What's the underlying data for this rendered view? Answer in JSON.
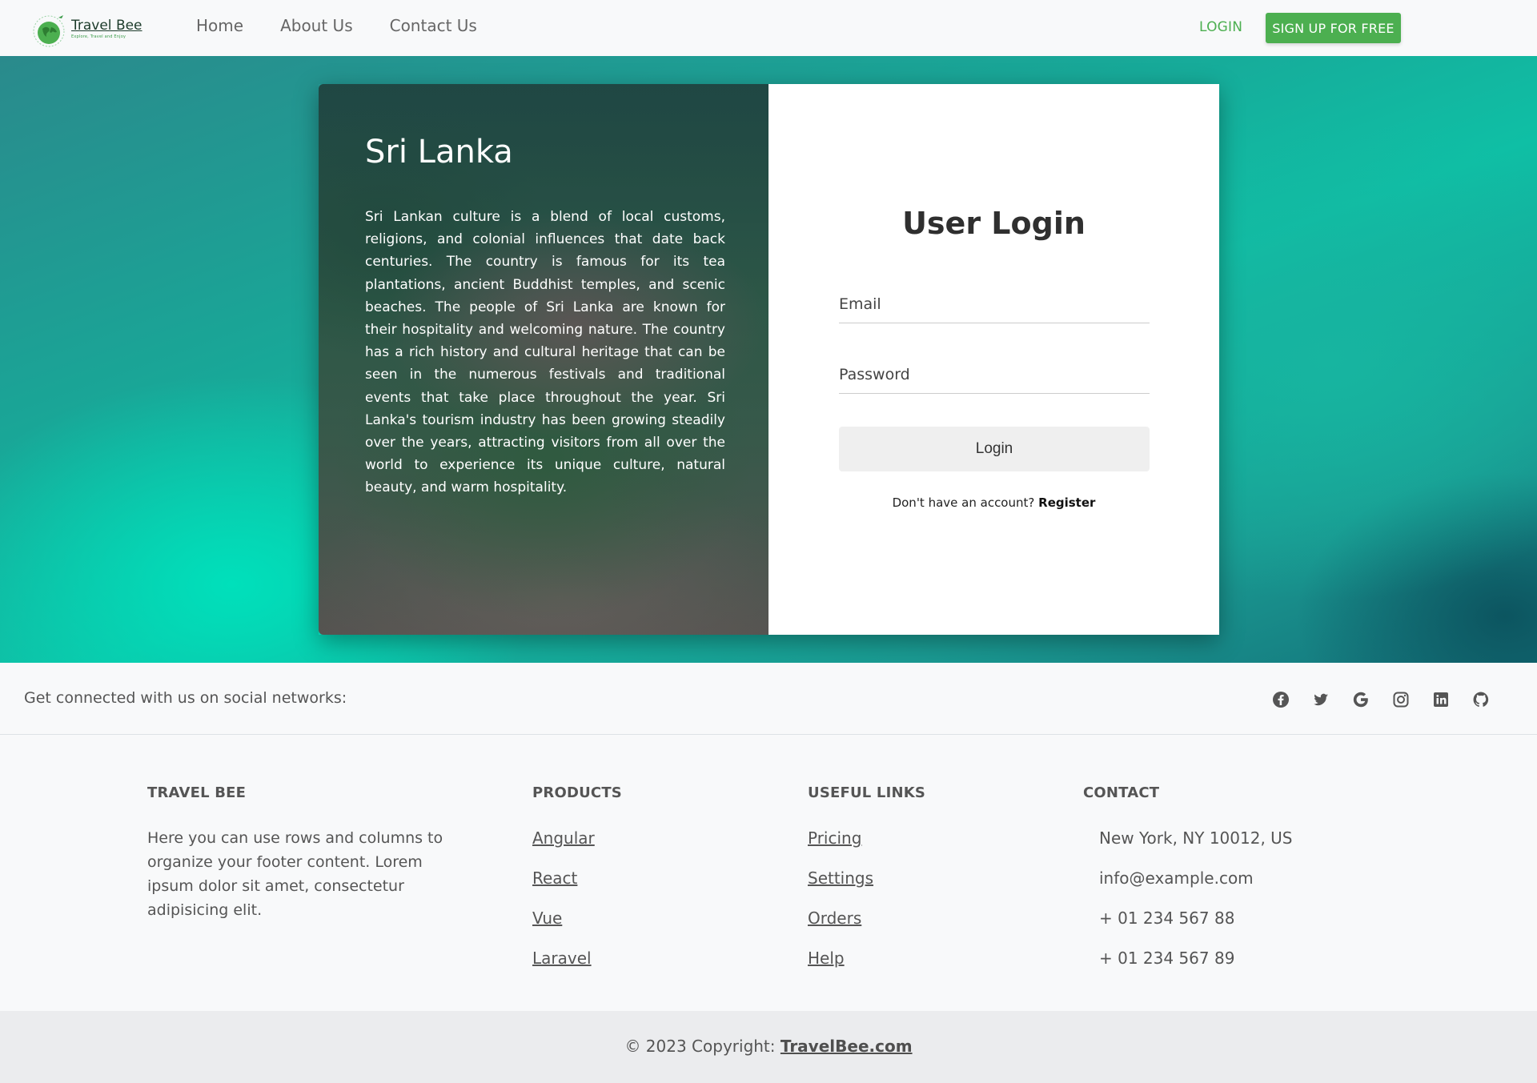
{
  "navbar": {
    "brand_name": "Travel Bee",
    "brand_tagline": "Explore, Travel and Enjoy",
    "links": [
      "Home",
      "About Us",
      "Contact Us"
    ],
    "login_label": "LOGIN",
    "signup_label": "SIGN UP FOR FREE"
  },
  "hero": {
    "title": "Sri Lanka",
    "description": "Sri Lankan culture is a blend of local customs, religions, and colonial influences that date back centuries. The country is famous for its tea plantations, ancient Buddhist temples, and scenic beaches. The people of Sri Lanka are known for their hospitality and welcoming nature. The country has a rich history and cultural heritage that can be seen in the numerous festivals and traditional events that take place throughout the year. Sri Lanka's tourism industry has been growing steadily over the years, attracting visitors from all over the world to experience its unique culture, natural beauty, and warm hospitality."
  },
  "login_form": {
    "title": "User Login",
    "email_placeholder": "Email",
    "password_placeholder": "Password",
    "submit_label": "Login",
    "register_prompt": "Don't have an account?",
    "register_link": "Register"
  },
  "social": {
    "text": "Get connected with us on social networks:",
    "icons": [
      "facebook-icon",
      "twitter-icon",
      "google-icon",
      "instagram-icon",
      "linkedin-icon",
      "github-icon"
    ]
  },
  "footer": {
    "about_title": "TRAVEL BEE",
    "about_text": "Here you can use rows and columns to organize your footer content. Lorem ipsum dolor sit amet, consectetur adipisicing elit.",
    "products_title": "PRODUCTS",
    "products": [
      "Angular",
      "React",
      "Vue",
      "Laravel"
    ],
    "useful_title": "USEFUL LINKS",
    "useful_links": [
      "Pricing",
      "Settings",
      "Orders",
      "Help"
    ],
    "contact_title": "CONTACT",
    "contact": [
      "New York, NY 10012, US",
      "info@example.com",
      "+ 01 234 567 88",
      "+ 01 234 567 89"
    ]
  },
  "copyright": {
    "text": "© 2023 Copyright:",
    "link": "TravelBee.com"
  },
  "colors": {
    "accent_green": "#4caf50",
    "hero_teal": "#0fbfa5"
  }
}
